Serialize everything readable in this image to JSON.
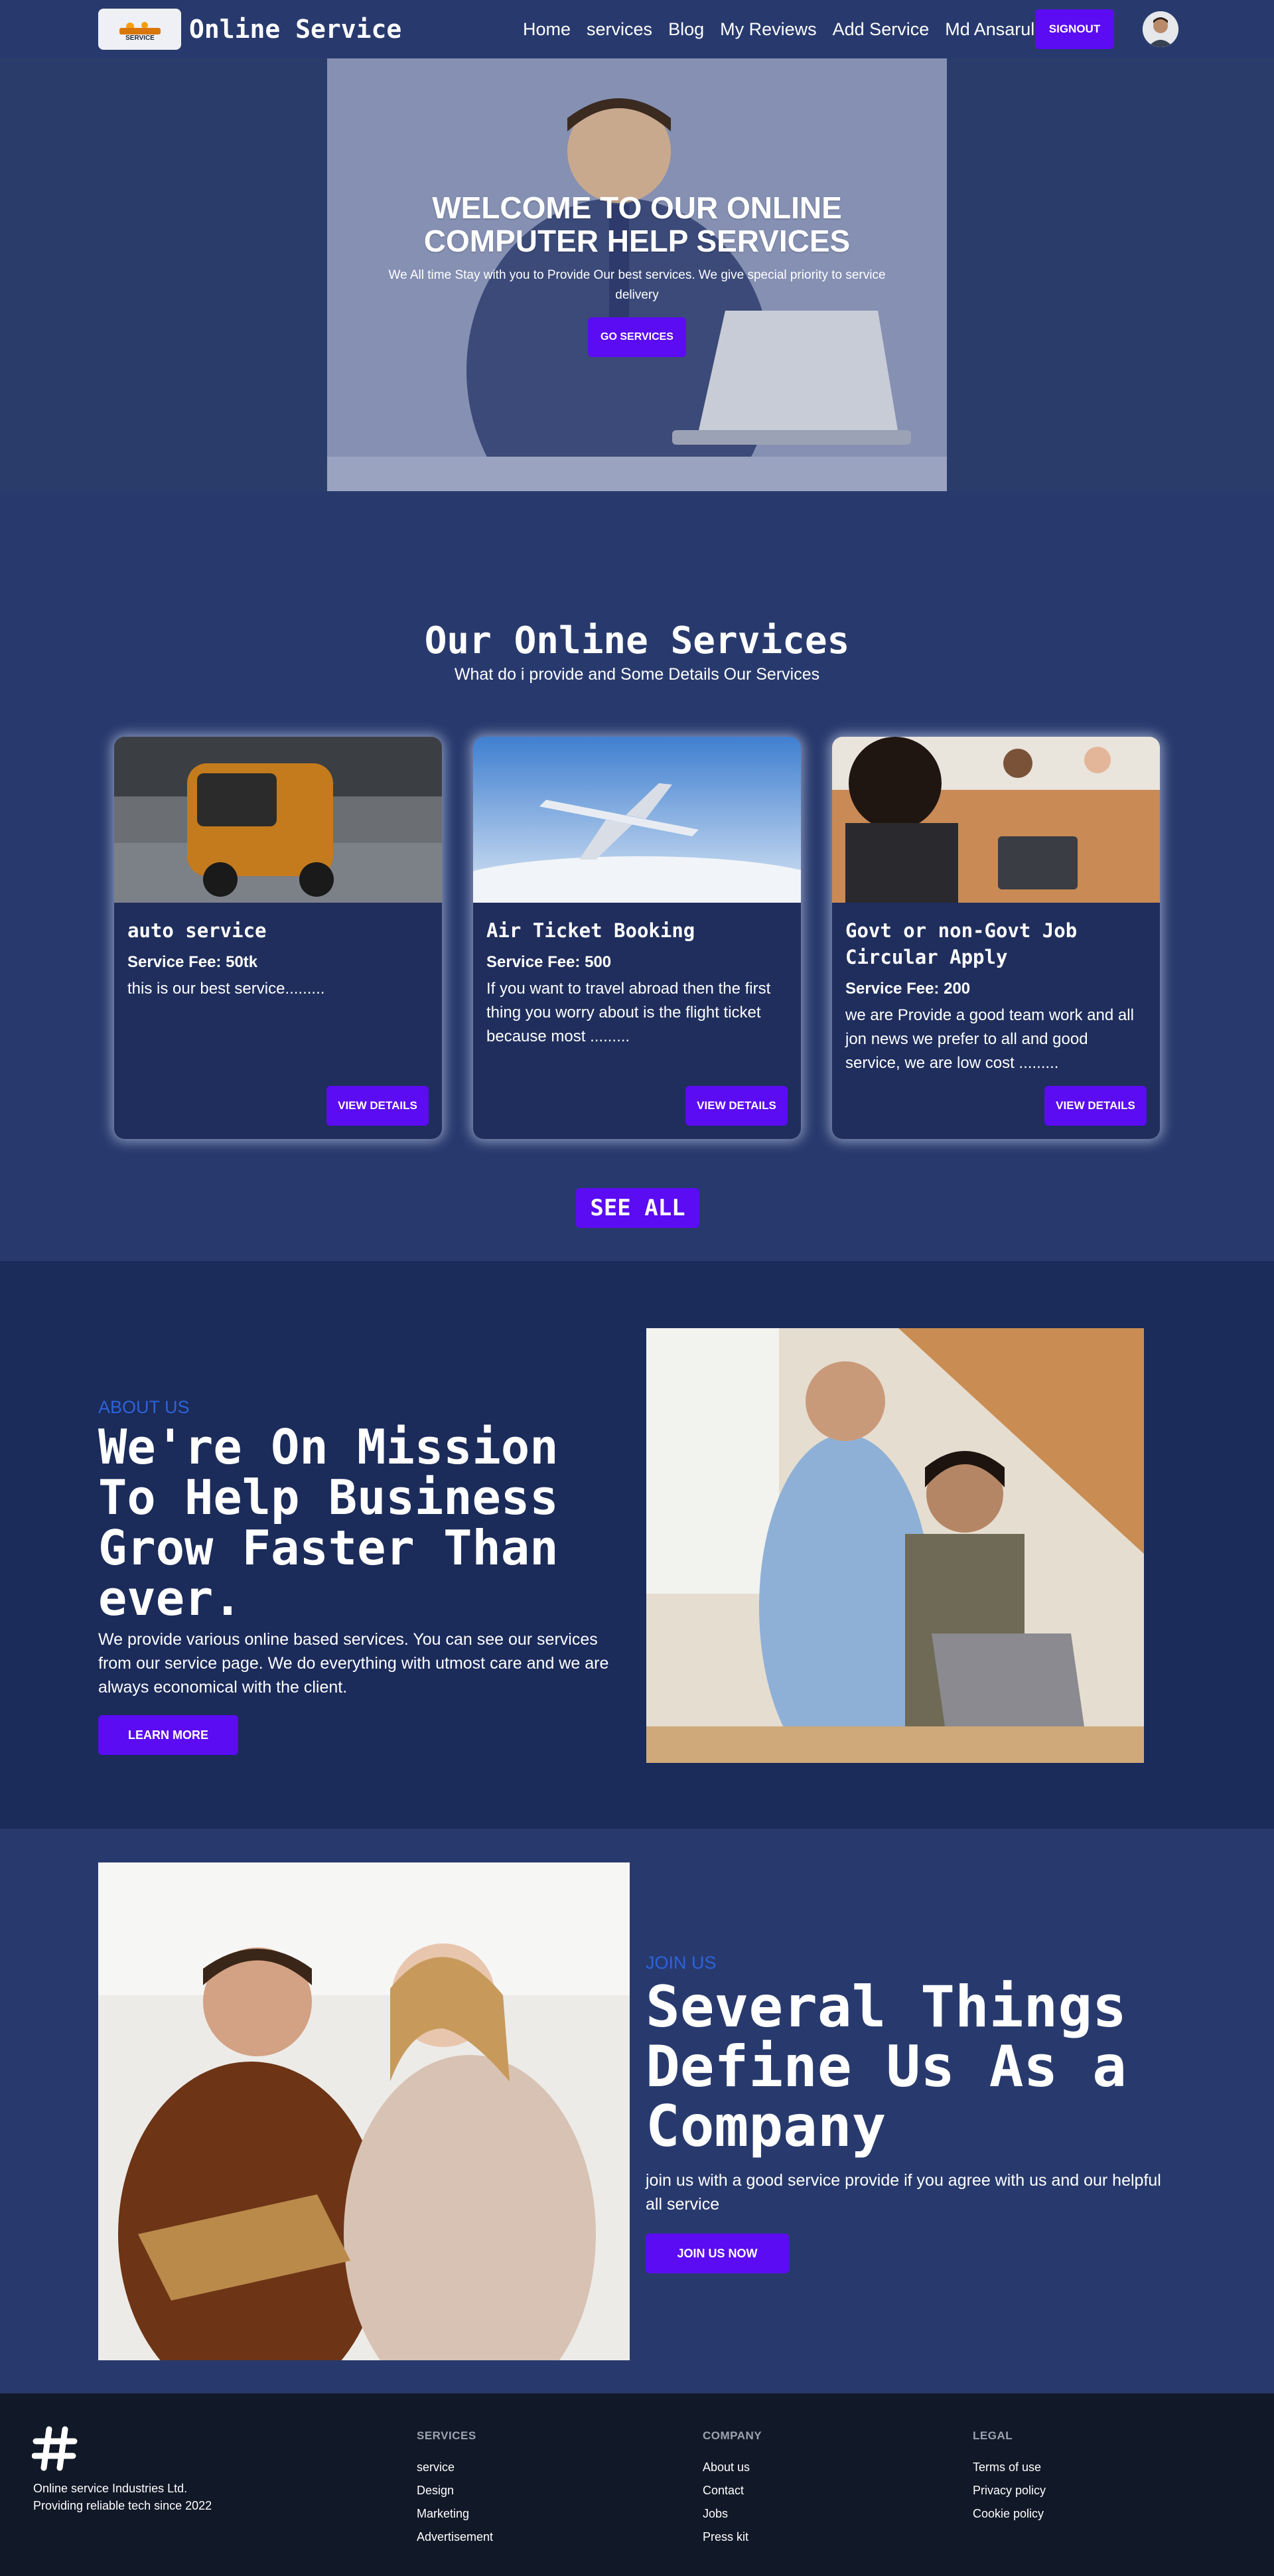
{
  "navbar": {
    "brand": "Online Service",
    "logo_text": "SERVICE",
    "links": [
      "Home",
      "services",
      "Blog",
      "My Reviews",
      "Add Service",
      "Md Ansarul Islam"
    ],
    "signout": "SIGNOUT"
  },
  "hero": {
    "title": "WELCOME TO OUR ONLINE COMPUTER HELP SERVICES",
    "subtitle": "We All time Stay with you to Provide Our best services. We give special priority to service delivery",
    "button": "GO SERVICES"
  },
  "services": {
    "title": "Our Online Services",
    "subtitle": "What do i provide and Some Details Our Services",
    "cards": [
      {
        "title": "auto service",
        "fee": "Service Fee: 50tk",
        "desc": "this is our best service.........",
        "button": "VIEW DETAILS"
      },
      {
        "title": "Air Ticket Booking",
        "fee": "Service Fee: 500",
        "desc": "If you want to travel abroad then the first thing you worry about is the flight ticket because most .........",
        "button": "VIEW DETAILS"
      },
      {
        "title": "Govt or non-Govt Job Circular Apply",
        "fee": "Service Fee: 200",
        "desc": "we are Provide a good team work and all jon news we prefer to all and good service, we are low cost .........",
        "button": "VIEW DETAILS"
      }
    ],
    "see_all": "SEE ALL"
  },
  "about": {
    "eyebrow": "ABOUT US",
    "title": "We're On Mission To Help Business Grow Faster Than ever.",
    "text": "We provide various online based services. You can see our services from our service page. We do everything with utmost care and we are always economical with the client.",
    "button": "LEARN MORE"
  },
  "join": {
    "eyebrow": "JOIN US",
    "title": "Several Things Define Us As a Company",
    "text": "join us with a good service provide if you agree with us and our helpful all service",
    "button": "JOIN US NOW"
  },
  "footer": {
    "company_name": "Online service Industries Ltd.",
    "tagline": "Providing reliable tech since 2022",
    "columns": [
      {
        "heading": "SERVICES",
        "links": [
          "service",
          "Design",
          "Marketing",
          "Advertisement"
        ]
      },
      {
        "heading": "COMPANY",
        "links": [
          "About us",
          "Contact",
          "Jobs",
          "Press kit"
        ]
      },
      {
        "heading": "LEGAL",
        "links": [
          "Terms of use",
          "Privacy policy",
          "Cookie policy"
        ]
      }
    ]
  },
  "colors": {
    "primary": "#5b0cf2",
    "nav_bg": "#283a6d",
    "accent_text": "#2c63d8",
    "footer_bg": "#111827"
  }
}
